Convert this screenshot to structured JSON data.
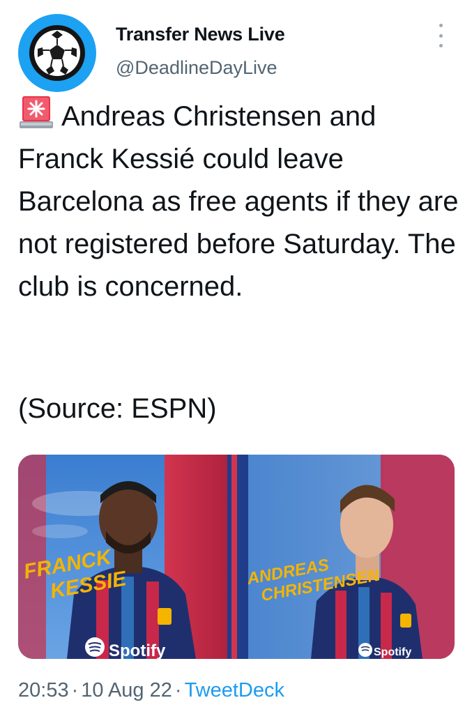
{
  "author": {
    "display_name": "Transfer News Live",
    "handle": "@DeadlineDayLive",
    "avatar_icon": "soccer-ball-icon"
  },
  "tweet": {
    "emoji_icon": "police-siren-icon",
    "text": "Andreas Christensen and Franck Kessié could leave Barcelona as free agents if they are not registered before Saturday. The club is concerned.",
    "source_line": "(Source: ESPN)"
  },
  "media": {
    "left_player_name_line1": "FRANCK",
    "left_player_name_line2": "KESSIE",
    "right_player_name_line1": "ANDREAS",
    "right_player_name_line2": "CHRISTENSEN",
    "sponsor": "Spotify",
    "colors": {
      "blue": "#2f6fb8",
      "red": "#c8284a",
      "gold": "#f4b400"
    }
  },
  "meta": {
    "time": "20:53",
    "date": "10 Aug 22",
    "separator": "·",
    "app": "TweetDeck"
  },
  "colors": {
    "accent": "#1d9bf0",
    "text": "#0f1419",
    "muted": "#536471"
  }
}
